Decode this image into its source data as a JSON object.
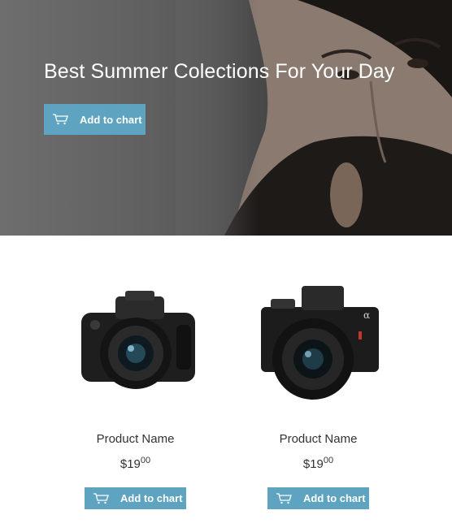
{
  "hero": {
    "title": "Best Summer Colections For Your Day",
    "button_label": "Add to chart",
    "icon": "cart-icon"
  },
  "products": [
    {
      "name": "Product Name",
      "price_main": "$19",
      "price_cents": "00",
      "button_label": "Add to chart",
      "image": "dslr-camera-image"
    },
    {
      "name": "Product Name",
      "price_main": "$19",
      "price_cents": "00",
      "button_label": "Add to chart",
      "image": "mirrorless-camera-image"
    }
  ],
  "colors": {
    "accent": "#5ea3bf",
    "text": "#333333",
    "hero_text": "#ffffff"
  }
}
